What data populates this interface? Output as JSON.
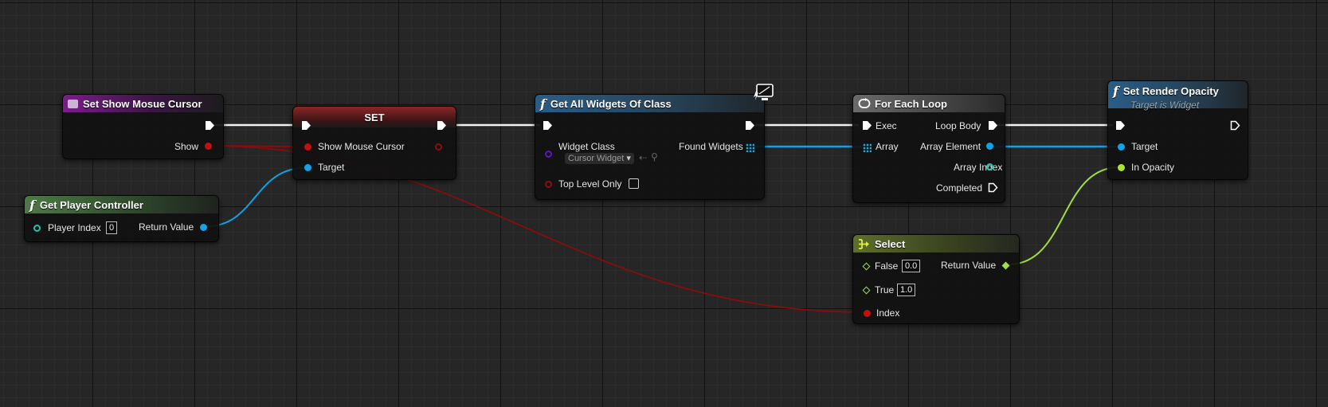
{
  "nodes": {
    "set_show_cursor": {
      "title": "Set Show Mosue Cursor",
      "pins": {
        "show": "Show"
      }
    },
    "set": {
      "title": "SET",
      "pins": {
        "show_mouse_cursor": "Show Mouse Cursor",
        "target": "Target"
      }
    },
    "get_player_controller": {
      "title": "Get Player Controller",
      "pins": {
        "player_index": "Player Index",
        "player_index_value": "0",
        "return_value": "Return Value"
      }
    },
    "get_all_widgets": {
      "title": "Get All Widgets Of Class",
      "pins": {
        "widget_class": "Widget Class",
        "widget_class_value": "Cursor Widget",
        "found_widgets": "Found Widgets",
        "top_level_only": "Top Level Only"
      }
    },
    "for_each_loop": {
      "title": "For Each Loop",
      "pins": {
        "exec": "Exec",
        "loop_body": "Loop Body",
        "array": "Array",
        "array_element": "Array Element",
        "array_index": "Array Index",
        "completed": "Completed"
      }
    },
    "set_render_opacity": {
      "title": "Set Render Opacity",
      "subtitle": "Target is Widget",
      "pins": {
        "target": "Target",
        "in_opacity": "In Opacity"
      }
    },
    "select": {
      "title": "Select",
      "pins": {
        "false": "False",
        "false_value": "0.0",
        "true": "True",
        "true_value": "1.0",
        "return_value": "Return Value",
        "index": "Index"
      }
    }
  },
  "icons": {
    "function": "function-icon",
    "event": "event-icon",
    "loop": "loop-icon",
    "select": "select-icon",
    "monitor": "monitor-icon"
  },
  "colors": {
    "exec_wire": "#ffffff",
    "bool_wire": "#8f0b0b",
    "object_wire": "#0fa3e6",
    "float_wire": "#9fe03a",
    "background": "#262626"
  }
}
